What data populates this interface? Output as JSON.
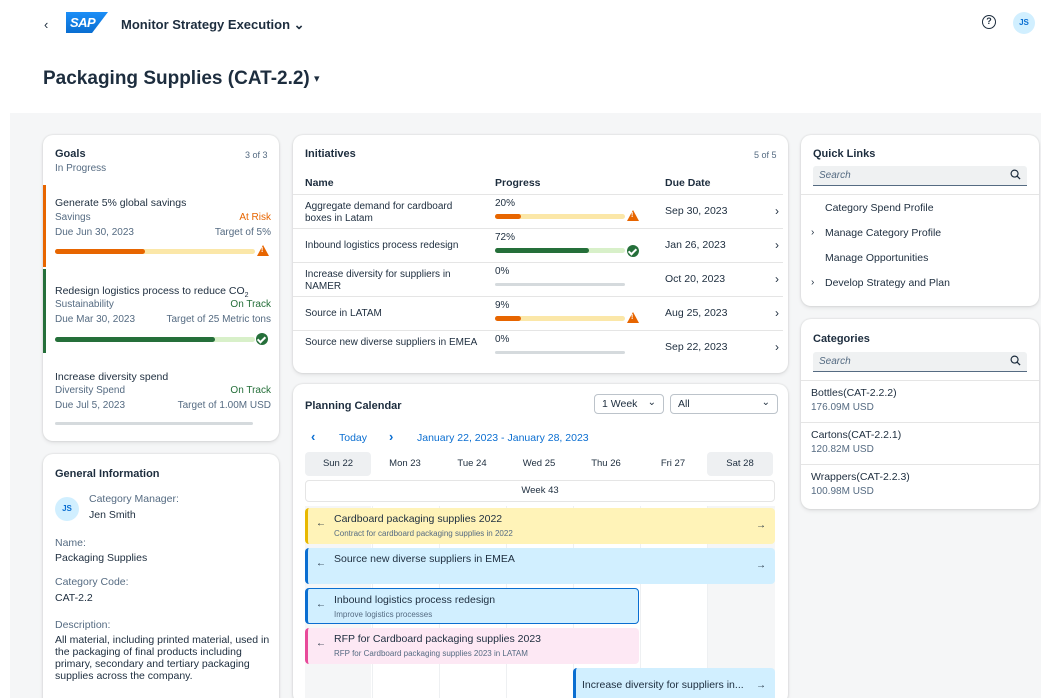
{
  "header": {
    "back_glyph": "‹",
    "logo_text": "SAP",
    "app_title": "Monitor Strategy Execution",
    "app_title_caret": "⌄",
    "help_glyph": "?",
    "user_initials": "JS"
  },
  "page": {
    "title": "Packaging Supplies (CAT-2.2)",
    "title_caret": "▾"
  },
  "goals": {
    "title": "Goals",
    "subtitle": "In Progress",
    "count": "3 of 3",
    "items": [
      {
        "title": "Generate 5% global savings",
        "category": "Savings",
        "status": "At Risk",
        "due": "Due Jun 30, 2023",
        "target": "Target of 5%",
        "progress": 0.45,
        "indicator": "warning-icon"
      },
      {
        "title": "Redesign logistics process to reduce CO",
        "title_sub": "2",
        "category": "Sustainability",
        "status": "On Track",
        "due": "Due Mar 30, 2023",
        "target": "Target of 25 Metric tons",
        "progress": 0.8,
        "indicator": "check-icon"
      },
      {
        "title": "Increase diversity spend",
        "category": "Diversity Spend",
        "status": "On Track",
        "due": "Due Jul 5, 2023",
        "target": "Target of 1.00M USD",
        "progress": 0.0,
        "indicator": "none"
      }
    ]
  },
  "general_info": {
    "title": "General Information",
    "manager_label": "Category Manager:",
    "manager_name": "Jen Smith",
    "manager_initials": "JS",
    "name_label": "Name:",
    "name_value": "Packaging Supplies",
    "code_label": "Category Code:",
    "code_value": "CAT-2.2",
    "desc_label": "Description:",
    "desc_value": "All material, including printed material, used in the packaging of final products including primary, secondary and tertiary packaging supplies across the company."
  },
  "initiatives": {
    "title": "Initiatives",
    "count": "5 of 5",
    "columns": [
      "Name",
      "Progress",
      "Due Date"
    ],
    "rows": [
      {
        "name": "Aggregate demand for cardboard boxes in Latam",
        "pct": "20%",
        "progress": 0.2,
        "due": "Sep 30, 2023",
        "state": "warning"
      },
      {
        "name": "Inbound logistics process redesign",
        "pct": "72%",
        "progress": 0.72,
        "due": "Jan 26, 2023",
        "state": "ok"
      },
      {
        "name": "Increase diversity for suppliers in NAMER",
        "pct": "0%",
        "progress": 0.0,
        "due": "Oct 20, 2023",
        "state": "none"
      },
      {
        "name": "Source in LATAM",
        "pct": "9%",
        "progress": 0.09,
        "due": "Aug 25, 2023",
        "state": "warning"
      },
      {
        "name": "Source new diverse suppliers in EMEA",
        "pct": "0%",
        "progress": 0.0,
        "due": "Sep 22, 2023",
        "state": "none"
      }
    ],
    "nav_glyph": "›"
  },
  "calendar": {
    "title": "Planning Calendar",
    "view_select": "1 Week",
    "filter_select": "All",
    "prev_glyph": "‹",
    "next_glyph": "›",
    "today_label": "Today",
    "range": "January 22, 2023 - January 28, 2023",
    "days": [
      "Sun 22",
      "Mon 23",
      "Tue 24",
      "Wed 25",
      "Thu 26",
      "Fri 27",
      "Sat 28"
    ],
    "week_label": "Week 43",
    "events": [
      {
        "title": "Cardboard packaging supplies 2022",
        "subtitle": "Contract for cardboard packaging supplies in 2022"
      },
      {
        "title": "Source new diverse suppliers in EMEA",
        "subtitle": ""
      },
      {
        "title": "Inbound logistics process redesign",
        "subtitle": "Improve logistics processes"
      },
      {
        "title": "RFP for Cardboard packaging supplies 2023",
        "subtitle": "RFP for Cardboard packaging supplies 2023 in LATAM"
      },
      {
        "title": "Increase diversity for suppliers in...",
        "subtitle": ""
      }
    ],
    "arrow_left": "←",
    "arrow_right": "→"
  },
  "quick_links": {
    "title": "Quick Links",
    "search_placeholder": "Search",
    "items": [
      {
        "label": "Category Spend Profile",
        "expandable": false
      },
      {
        "label": "Manage Category Profile",
        "expandable": true
      },
      {
        "label": "Manage Opportunities",
        "expandable": false
      },
      {
        "label": "Develop Strategy and Plan",
        "expandable": true
      }
    ],
    "chevron_glyph": "›"
  },
  "categories": {
    "title": "Categories",
    "search_placeholder": "Search",
    "items": [
      {
        "name": "Bottles(CAT-2.2.2)",
        "value": "176.09M USD"
      },
      {
        "name": "Cartons(CAT-2.2.1)",
        "value": "120.82M USD"
      },
      {
        "name": "Wrappers(CAT-2.2.3)",
        "value": "100.98M USD"
      }
    ]
  },
  "colors": {
    "risk": "#e76500",
    "ok": "#256f3a",
    "accent": "#0a6ed1",
    "warn_track": "#fbe7a8",
    "ok_track": "#d8f0c9",
    "ev_yellow": "#fff3b8",
    "ev_yellow_border": "#e8b800",
    "ev_blue": "#d1efff",
    "ev_blue_border": "#0a6ed1",
    "ev_pink": "#fde8f4",
    "ev_pink_border": "#e84a9a"
  }
}
